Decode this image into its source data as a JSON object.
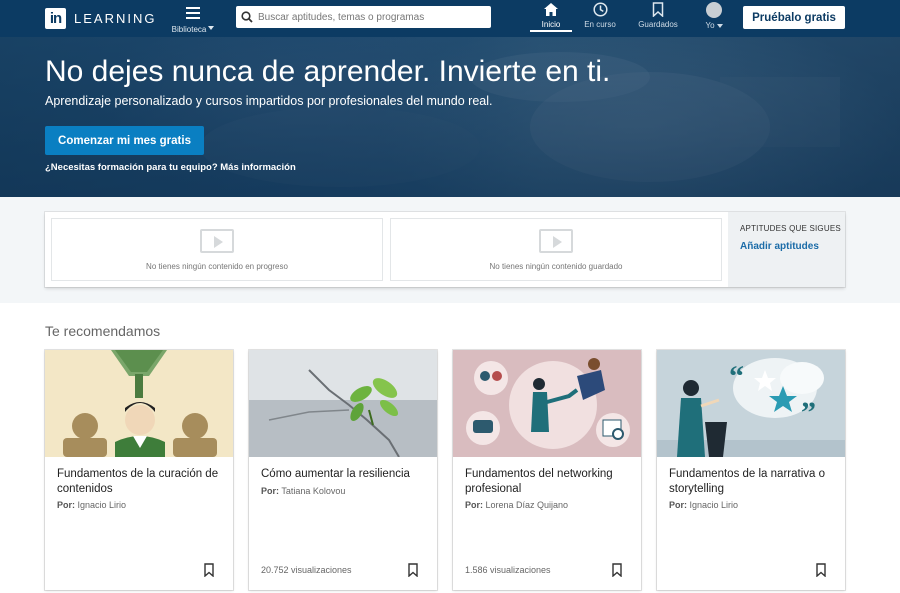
{
  "nav": {
    "logo_box": "in",
    "logo_text": "LEARNING",
    "library_label": "Biblioteca",
    "search_placeholder": "Buscar aptitudes, temas o programas",
    "items": [
      {
        "label": "Inicio",
        "icon": "home-icon",
        "active": true
      },
      {
        "label": "En curso",
        "icon": "clock-icon",
        "active": false
      },
      {
        "label": "Guardados",
        "icon": "bookmark-icon",
        "active": false
      },
      {
        "label": "Yo",
        "icon": "avatar",
        "active": false
      }
    ],
    "try_button": "Pruébalo gratis"
  },
  "hero": {
    "title": "No dejes nunca de aprender. Invierte en ti.",
    "subtitle": "Aprendizaje personalizado y cursos impartidos por profesionales del mundo real.",
    "cta": "Comenzar mi mes gratis",
    "team_link": "¿Necesitas formación para tu equipo? Más información"
  },
  "status": {
    "in_progress_empty": "No tienes ningún contenido en progreso",
    "saved_empty": "No tienes ningún contenido guardado",
    "skills_heading": "APTITUDES QUE SIGUES",
    "add_skills": "Añadir aptitudes"
  },
  "recommendations": {
    "heading": "Te recomendamos",
    "courses": [
      {
        "title": "Fundamentos de la curación de contenidos",
        "by_label": "Por:",
        "author": "Ignacio Lirio",
        "views": ""
      },
      {
        "title": "Cómo aumentar la resiliencia",
        "by_label": "Por:",
        "author": "Tatiana Kolovou",
        "views": "20.752 visualizaciones"
      },
      {
        "title": "Fundamentos del networking profesional",
        "by_label": "Por:",
        "author": "Lorena Díaz Quijano",
        "views": "1.586 visualizaciones"
      },
      {
        "title": "Fundamentos de la narrativa o storytelling",
        "by_label": "Por:",
        "author": "Ignacio Lirio",
        "views": ""
      }
    ]
  },
  "colors": {
    "nav_bg": "#0c3b63",
    "cta_blue": "#0a7fc2",
    "link_blue": "#1b6ca8"
  }
}
